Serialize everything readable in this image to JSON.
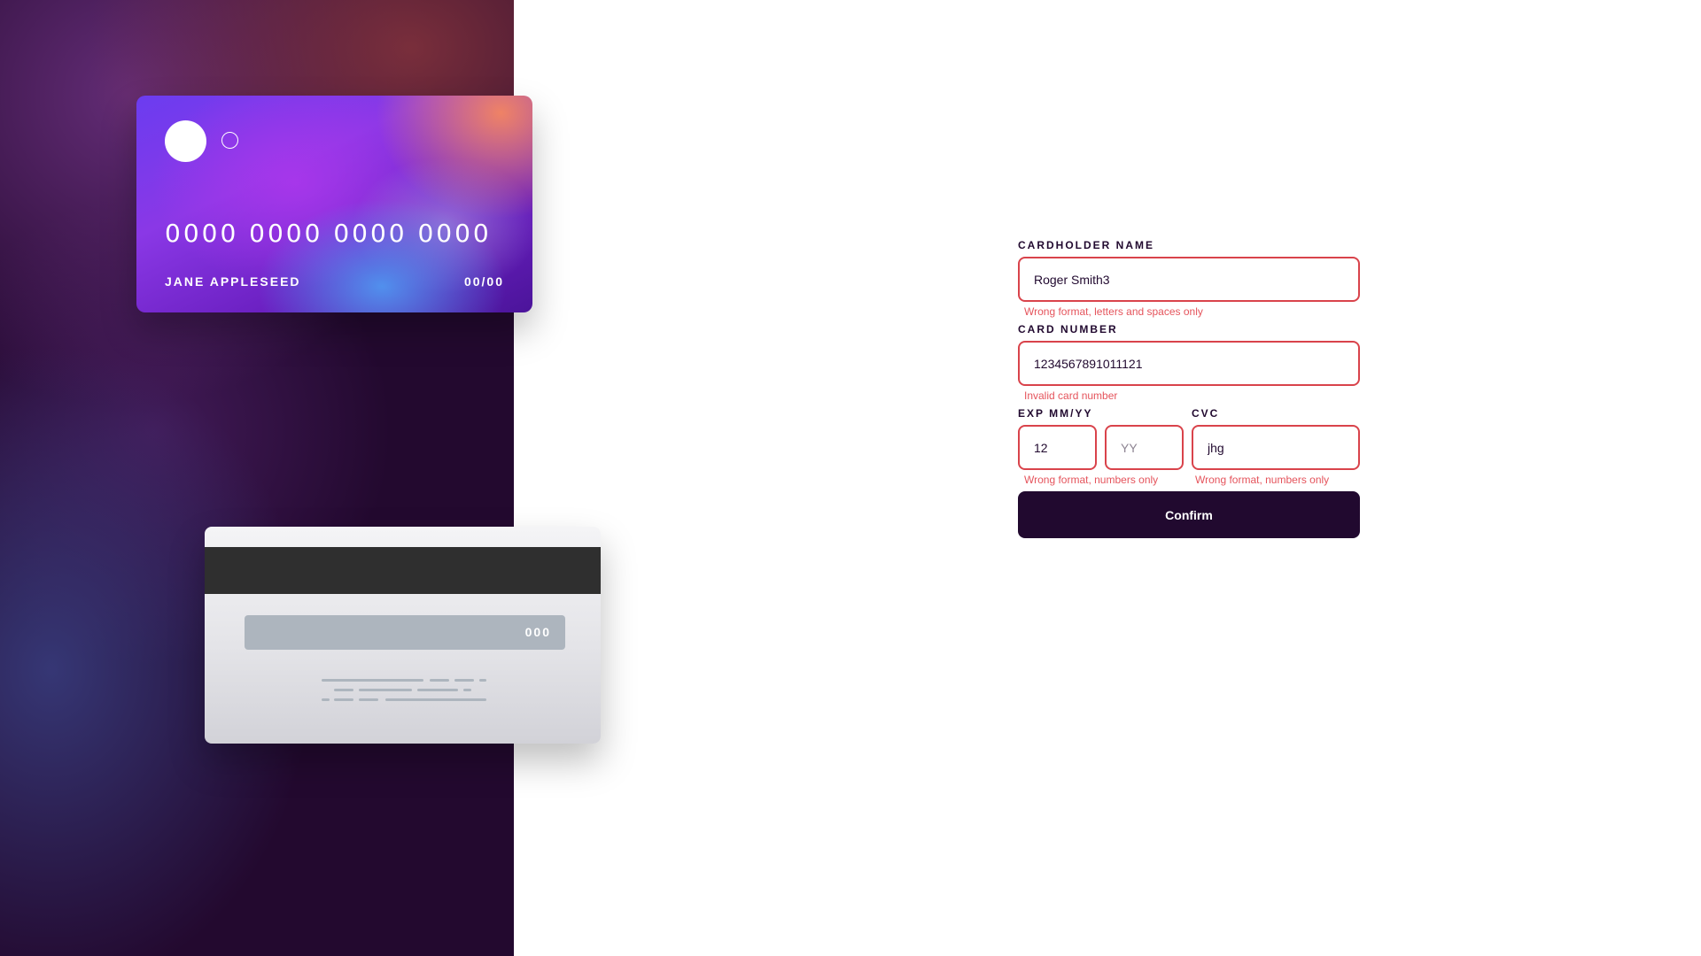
{
  "card_front": {
    "number": "0000 0000 0000 0000",
    "name": "JANE APPLESEED",
    "expiry": "00/00"
  },
  "card_back": {
    "cvc": "000"
  },
  "form": {
    "name_label": "CARDHOLDER NAME",
    "name_value": "Roger Smith3",
    "name_error": "Wrong format, letters and spaces only",
    "number_label": "CARD NUMBER",
    "number_value": "123456789101112​1",
    "number_error": "Invalid card number",
    "exp_label": "EXP MM/YY",
    "exp_month_value": "12",
    "exp_year_placeholder": "YY",
    "exp_error": "Wrong format, numbers only",
    "cvc_label": "CVC",
    "cvc_value": "jhg",
    "cvc_error": "Wrong format, numbers only",
    "confirm_label": "Confirm"
  },
  "colors": {
    "dark": "#21092f",
    "error": "#e5545c",
    "error_border": "#d9434b"
  }
}
